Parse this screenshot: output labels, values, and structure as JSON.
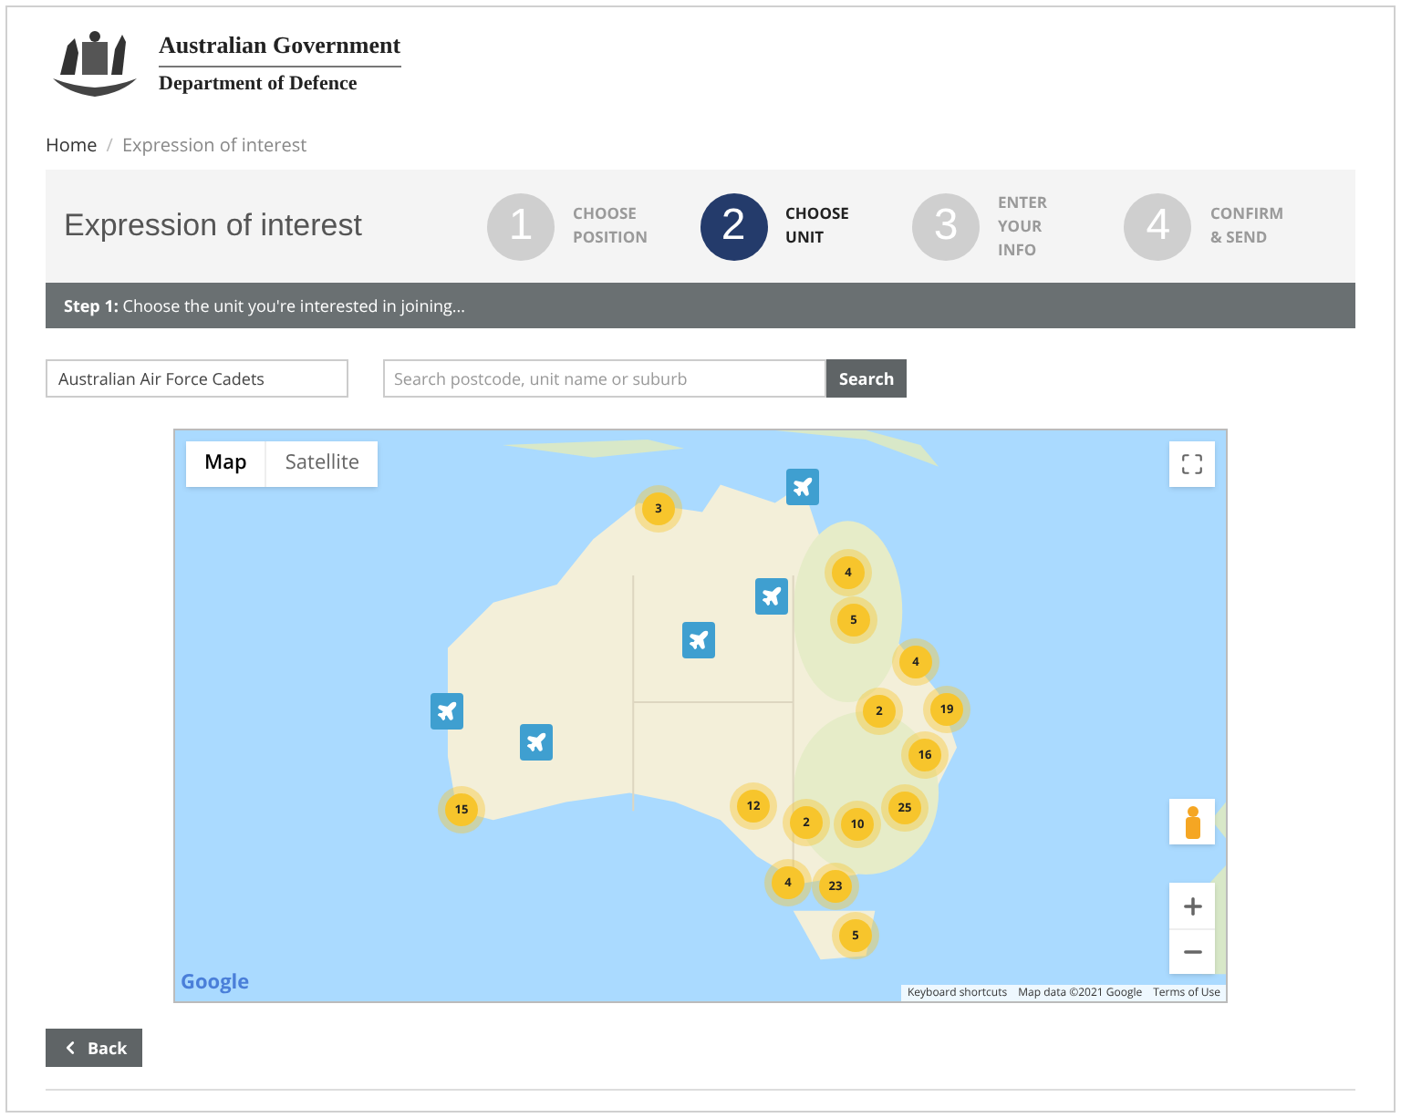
{
  "header": {
    "title": "Australian Government",
    "subtitle": "Department of Defence"
  },
  "breadcrumb": [
    {
      "label": "Home",
      "current": false
    },
    {
      "label": "Expression of interest",
      "current": true
    }
  ],
  "breadcrumb_separator": "/",
  "page_title": "Expression of interest",
  "steps": [
    {
      "number": "1",
      "label": "CHOOSE POSITION",
      "selected": false
    },
    {
      "number": "2",
      "label": "CHOOSE UNIT",
      "selected": true
    },
    {
      "number": "3",
      "label": "ENTER YOUR INFO",
      "selected": false
    },
    {
      "number": "4",
      "label": "CONFIRM & SEND",
      "selected": false
    }
  ],
  "instruction": "**Step 1:** Choose the unit you're interested in joining...",
  "filters": {
    "unit_type": "Australian Air Force Cadets",
    "search_placeholder": "Search postcode, unit name or suburb",
    "search_button": "Search"
  },
  "map": {
    "tabs": [
      {
        "label": "Map",
        "selected": true
      },
      {
        "label": "Satellite",
        "selected": false
      }
    ],
    "clusters": [
      {
        "count": "3"
      },
      {
        "count": "4"
      },
      {
        "count": "5"
      },
      {
        "count": "4"
      },
      {
        "count": "2"
      },
      {
        "count": "19"
      },
      {
        "count": "16"
      },
      {
        "count": "12"
      },
      {
        "count": "2"
      },
      {
        "count": "10"
      },
      {
        "count": "25"
      },
      {
        "count": "4"
      },
      {
        "count": "23"
      },
      {
        "count": "5"
      },
      {
        "count": "15"
      }
    ],
    "unit_markers": [
      {
        "kind": "plane"
      },
      {
        "kind": "plane"
      },
      {
        "kind": "plane"
      },
      {
        "kind": "plane"
      },
      {
        "kind": "plane"
      }
    ],
    "logo": "Google",
    "footer_links": [
      "Keyboard shortcuts",
      "Map data ©2021 Google",
      "Terms of Use"
    ]
  },
  "back_button": "Back"
}
